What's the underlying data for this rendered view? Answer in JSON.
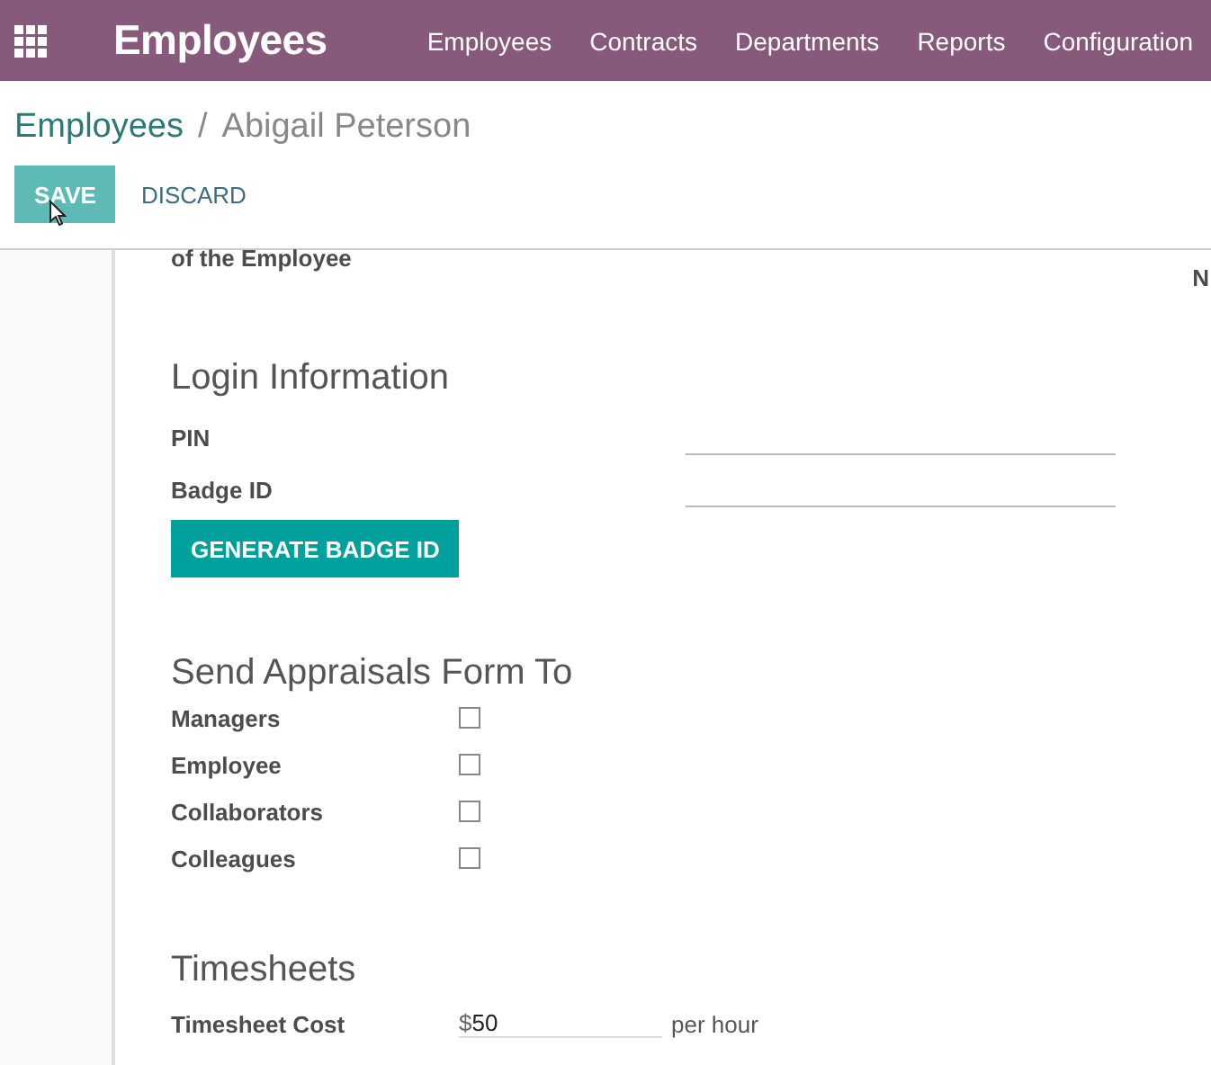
{
  "navbar": {
    "app_title": "Employees",
    "menu": [
      "Employees",
      "Contracts",
      "Departments",
      "Reports",
      "Configuration"
    ]
  },
  "breadcrumb": {
    "parent": "Employees",
    "separator": "/",
    "current": "Abigail Peterson"
  },
  "actions": {
    "save": "SAVE",
    "discard": "DISCARD"
  },
  "sheet": {
    "cut_label": "of the Employee",
    "cut_right": "N",
    "login": {
      "heading": "Login Information",
      "fields": [
        {
          "label": "PIN"
        },
        {
          "label": "Badge ID"
        }
      ],
      "button": "GENERATE BADGE ID"
    },
    "appraisals": {
      "heading": "Send Appraisals Form To",
      "options": [
        {
          "label": "Managers",
          "checked": false
        },
        {
          "label": "Employee",
          "checked": false
        },
        {
          "label": "Collaborators",
          "checked": false
        },
        {
          "label": "Colleagues",
          "checked": false
        }
      ]
    },
    "timesheets": {
      "heading": "Timesheets",
      "label": "Timesheet Cost",
      "currency": "$",
      "value": "50",
      "unit": "per hour"
    }
  }
}
